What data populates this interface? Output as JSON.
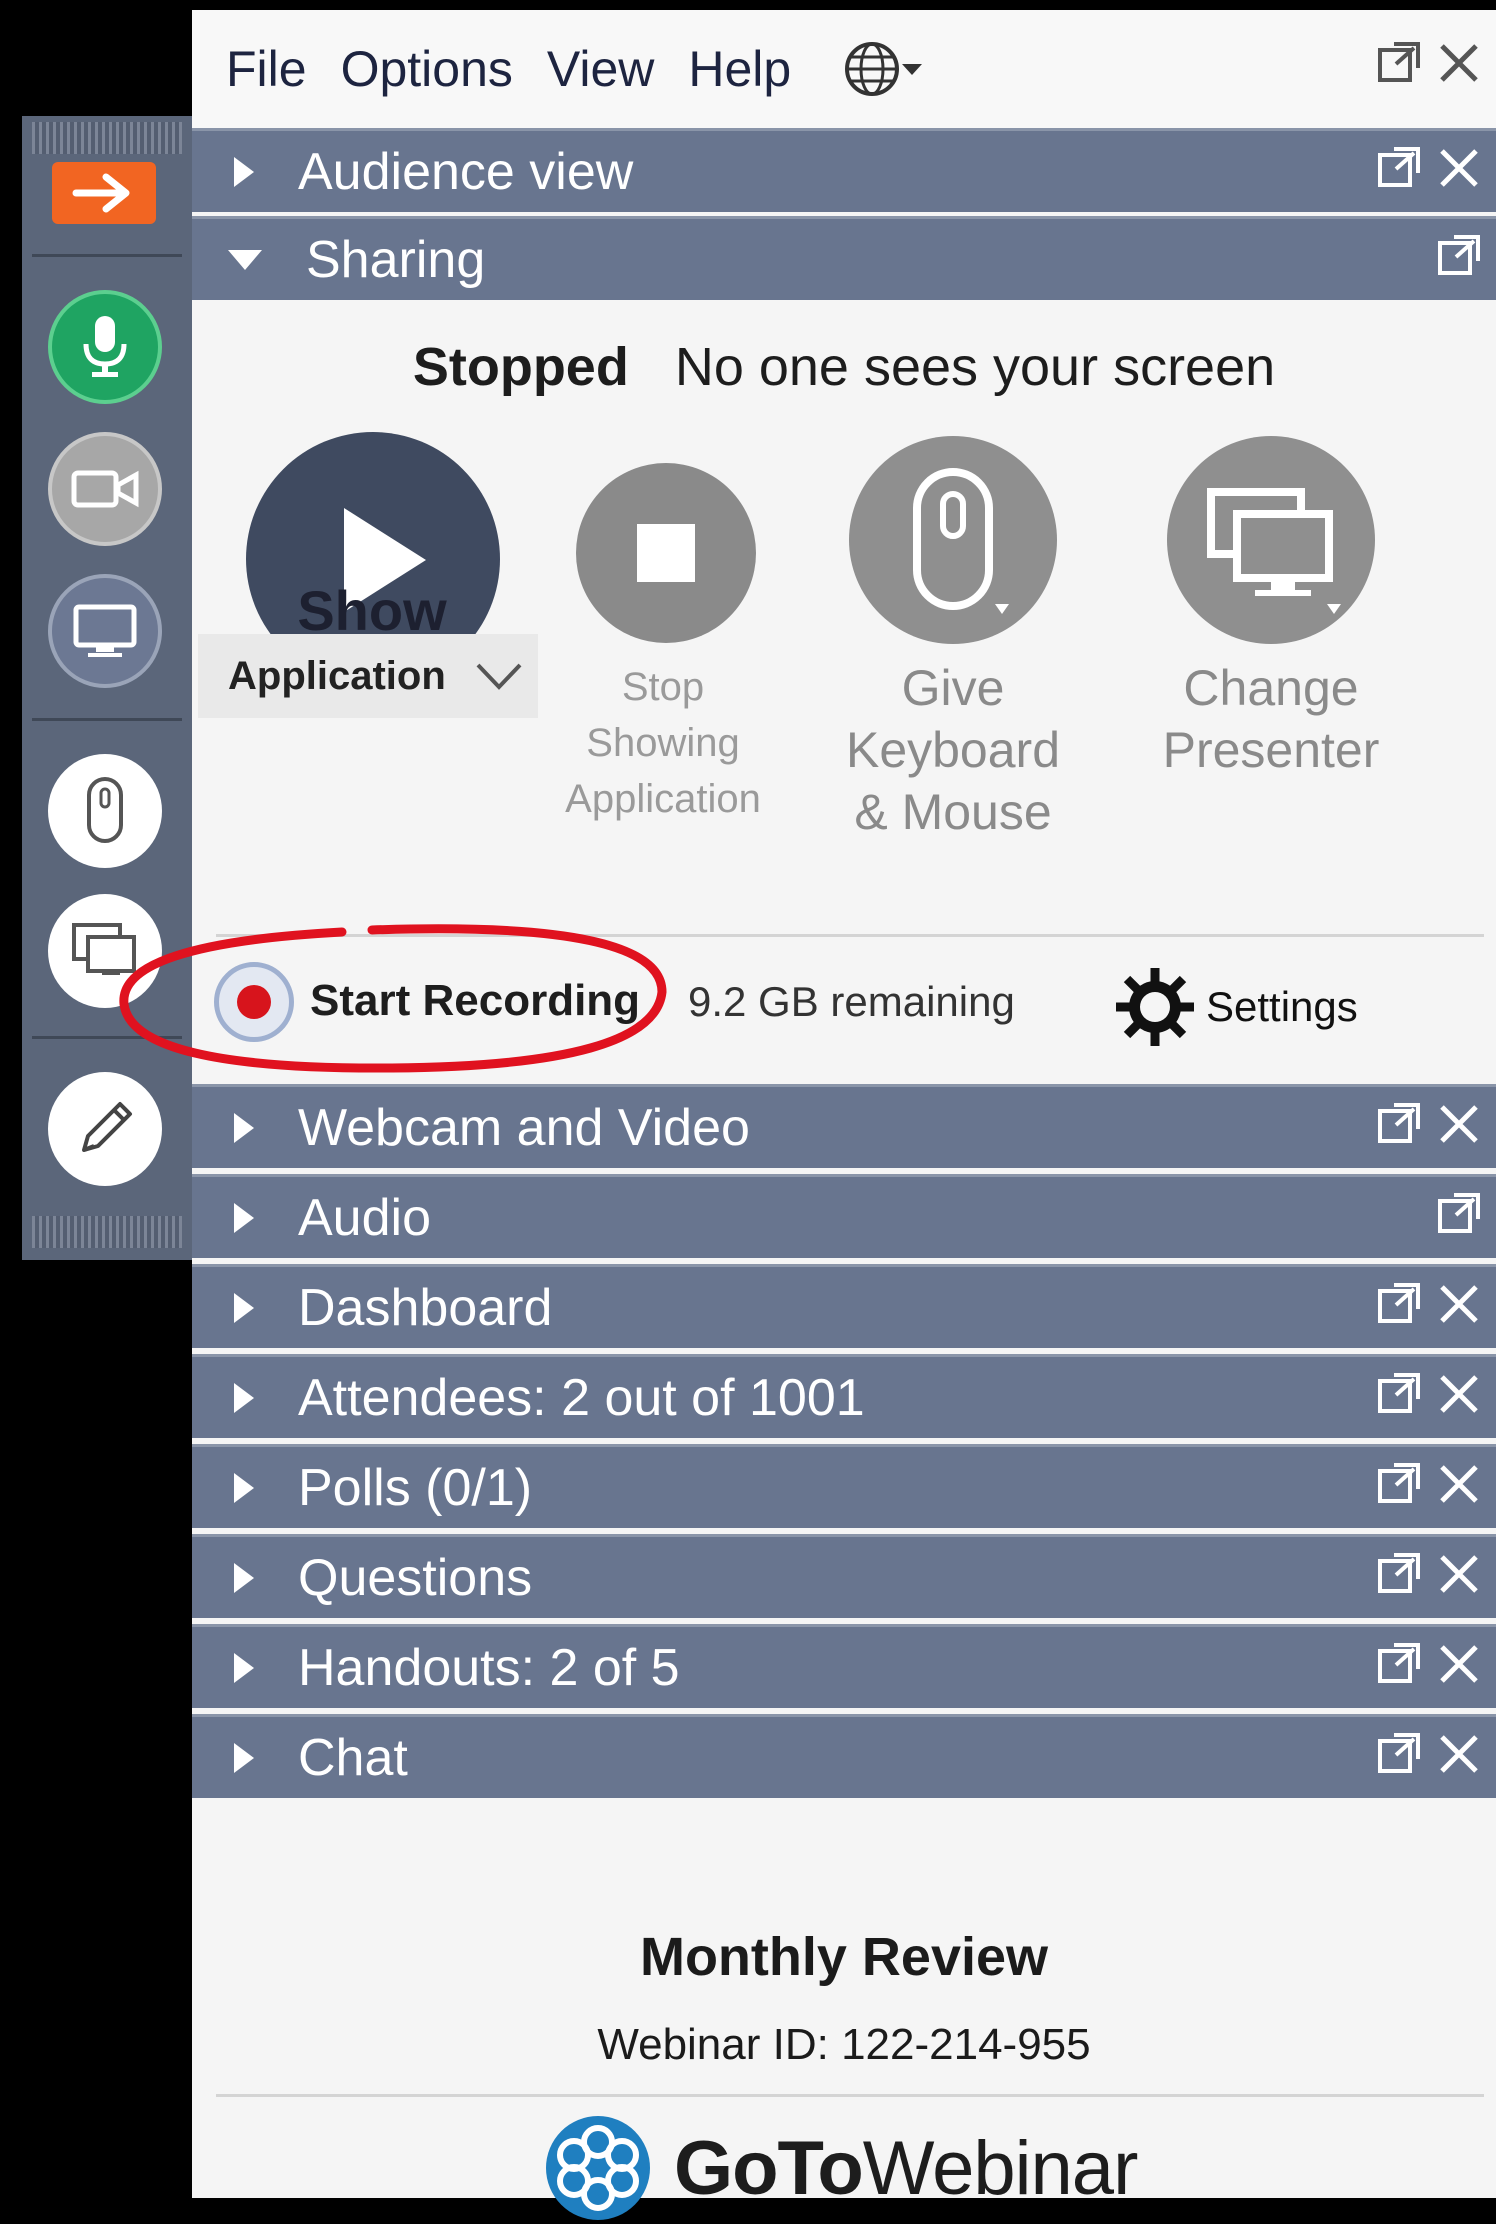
{
  "menu": {
    "items": [
      "File",
      "Options",
      "View",
      "Help"
    ]
  },
  "sections": {
    "audience_view": "Audience view",
    "sharing": "Sharing",
    "webcam": "Webcam and Video",
    "audio": "Audio",
    "dashboard": "Dashboard",
    "attendees": "Attendees:  2 out of 1001",
    "polls": "Polls (0/1)",
    "questions": "Questions",
    "handouts": "Handouts: 2 of 5",
    "chat": "Chat"
  },
  "sharing": {
    "status": "Stopped",
    "status_detail": "No one sees your screen",
    "show_label": "Show",
    "show_mode": "Application",
    "stop_label": [
      "Stop",
      "Showing",
      "Application"
    ],
    "keyboard_label": [
      "Give",
      "Keyboard",
      "& Mouse"
    ],
    "presenter_label": [
      "Change",
      "Presenter"
    ]
  },
  "recording": {
    "label": "Start Recording",
    "storage": "9.2 GB remaining",
    "settings_label": "Settings"
  },
  "footer": {
    "webinar_title": "Monthly Review",
    "webinar_id": "Webinar ID: 122-214-955",
    "logo_bold": "GoTo",
    "logo_light": "Webinar"
  },
  "colors": {
    "accent_orange": "#f26522",
    "mic_green": "#1fa462",
    "header_blue": "#68758f",
    "record_red": "#d7141c",
    "annotation_red": "#e0121f"
  },
  "icons": [
    "arrow-right-icon",
    "microphone-icon",
    "webcam-icon",
    "screen-icon",
    "mouse-icon",
    "presenter-icon",
    "pen-icon",
    "globe-icon",
    "popout-icon",
    "close-icon",
    "gear-icon",
    "gotowebinar-logo-icon"
  ]
}
